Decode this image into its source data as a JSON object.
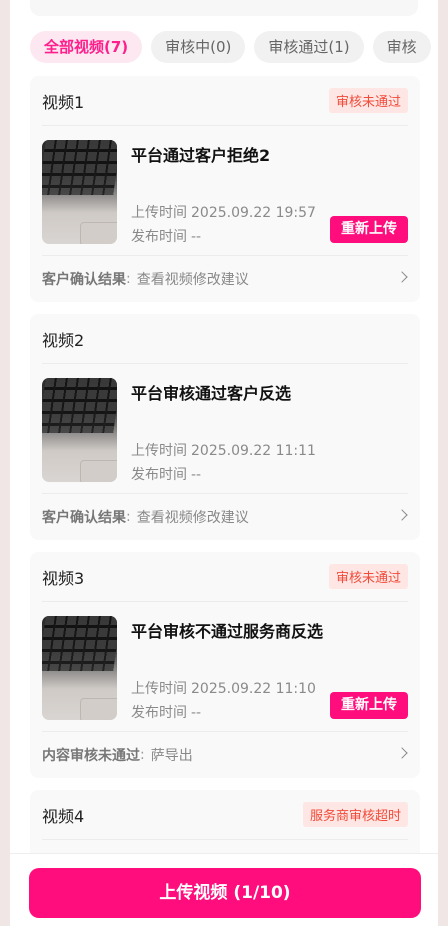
{
  "tabs": [
    {
      "label": "全部视频(7)",
      "active": true
    },
    {
      "label": "审核中(0)",
      "active": false
    },
    {
      "label": "审核通过(1)",
      "active": false
    },
    {
      "label": "审核",
      "active": false
    }
  ],
  "videos": [
    {
      "title": "视频1",
      "badge": "审核未通过",
      "name": "平台通过客户拒绝2",
      "upload_label": "上传时间",
      "upload_time": "2025.09.22 19:57",
      "publish_label": "发布时间",
      "publish_time": "--",
      "action": "重新上传",
      "foot_label": "客户确认结果",
      "foot_sep": ":",
      "foot_value": "查看视频修改建议"
    },
    {
      "title": "视频2",
      "badge": "",
      "name": "平台审核通过客户反选",
      "upload_label": "上传时间",
      "upload_time": "2025.09.22 11:11",
      "publish_label": "发布时间",
      "publish_time": "--",
      "action": "",
      "foot_label": "客户确认结果",
      "foot_sep": ":",
      "foot_value": "查看视频修改建议"
    },
    {
      "title": "视频3",
      "badge": "审核未通过",
      "name": "平台审核不通过服务商反选",
      "upload_label": "上传时间",
      "upload_time": "2025.09.22 11:10",
      "publish_label": "发布时间",
      "publish_time": "--",
      "action": "重新上传",
      "foot_label": "内容审核未通过",
      "foot_sep": ":",
      "foot_value": "萨导出"
    },
    {
      "title": "视频4",
      "badge": "服务商审核超时"
    }
  ],
  "upload_button": "上传视频 (1/10)",
  "colors": {
    "accent": "#ff0d7d",
    "badge_text": "#f24b3a",
    "badge_bg": "#fde6e3"
  }
}
